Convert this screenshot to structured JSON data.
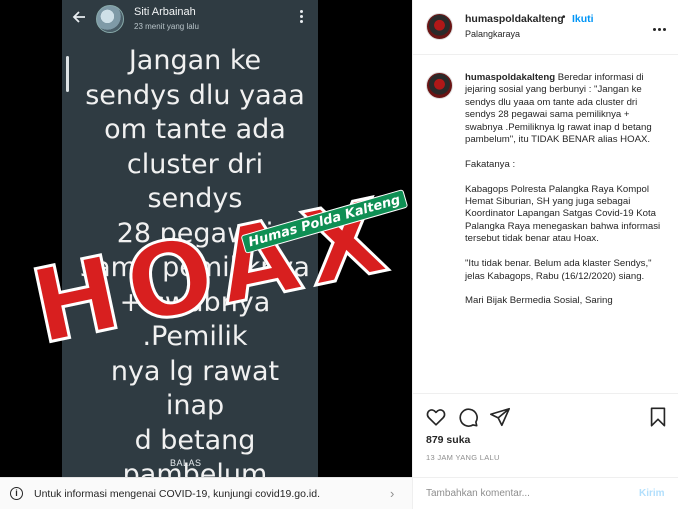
{
  "media": {
    "status_author": "Siti Arbainah",
    "status_time": "23 menit yang lalu",
    "status_text": "Jangan ke\nsendys dlu yaaa\nom tante ada\ncluster dri sendys\n28 pegawai\nsama pemiliknya\n+ swabnya .Pemilik\nnya lg rawat inap\nd betang\npambelum",
    "reply_label": "BALAS",
    "stamp_text": "HOAX",
    "watermark_text": "Humas Polda Kalteng",
    "stamp_color": "#d81f1f",
    "watermark_color": "#0f8f54"
  },
  "covid_banner": {
    "text": "Untuk informasi mengenai COVID-19, kunjungi covid19.go.id."
  },
  "post": {
    "username": "humaspoldakalteng",
    "dot": "•",
    "follow_label": "Ikuti",
    "location": "Palangkaraya",
    "caption_user": "humaspoldakalteng",
    "caption": " Beredar informasi di jejaring sosial yang berbunyi : \"Jangan ke sendys dlu yaaa om tante ada cluster dri sendys 28 pegawai sama pemiliknya + swabnya .Pemiliknya lg rawat inap d betang pambelum\", itu TIDAK BENAR alias HOAX.\n\nFakatanya :\n\nKabagops Polresta Palangka Raya Kompol Hemat Siburian, SH yang juga sebagai Koordinator Lapangan Satgas Covid-19 Kota Palangka Raya menegaskan bahwa informasi tersebut tidak benar atau Hoax.\n\n\"Itu tidak benar. Belum ada klaster Sendys,\" jelas Kabagops, Rabu (16/12/2020) siang.\n\nMari Bijak Bermedia Sosial, Saring",
    "likes": "879 suka",
    "time_ago": "13 JAM YANG LALU",
    "comment_placeholder": "Tambahkan komentar...",
    "send_label": "Kirim",
    "accent_color": "#0095f6"
  },
  "icons": [
    "back-arrow-icon",
    "more-vertical-icon",
    "info-icon",
    "chevron-right-icon",
    "more-horizontal-icon",
    "heart-icon",
    "comment-icon",
    "share-icon",
    "bookmark-icon"
  ]
}
